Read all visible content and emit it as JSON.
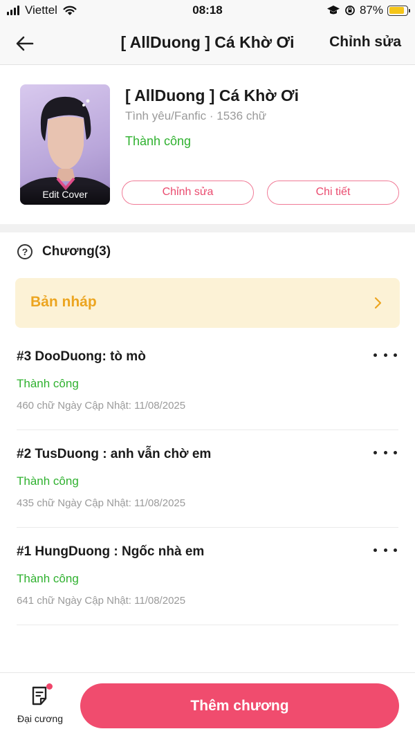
{
  "status_bar": {
    "carrier": "Viettel",
    "time": "08:18",
    "battery": "87%",
    "battery_level": 0.87
  },
  "nav": {
    "title": "[ AllDuong ] Cá Khờ Ơi",
    "edit_label": "Chỉnh sửa",
    "back_icon": "arrow-left-icon"
  },
  "story": {
    "cover_label": "Edit Cover",
    "title": "[ AllDuong ] Cá Khờ Ơi",
    "meta": "Tình yêu/Fanfic · 1536 chữ",
    "status": "Thành công",
    "edit_button": "Chỉnh sửa",
    "detail_button": "Chi tiết"
  },
  "chapters": {
    "heading": "Chương(3)",
    "draft_label": "Bản nháp",
    "items": [
      {
        "title": "#3 DooDuong: tò mò",
        "status": "Thành công",
        "meta": "460 chữ Ngày Cập Nhật: 11/08/2025"
      },
      {
        "title": "#2 TusDuong : anh vẫn chờ em",
        "status": "Thành công",
        "meta": "435 chữ Ngày Cập Nhật: 11/08/2025"
      },
      {
        "title": "#1 HungDuong : Ngốc nhà em",
        "status": "Thành công",
        "meta": "641 chữ Ngày Cập Nhật: 11/08/2025"
      }
    ]
  },
  "bottom": {
    "outline_label": "Đại cương",
    "add_button": "Thêm chương"
  },
  "colors": {
    "accent": "#f04c6e",
    "success": "#2fb12f",
    "draft_bg": "#fcf2d6",
    "draft_text": "#eca520"
  }
}
